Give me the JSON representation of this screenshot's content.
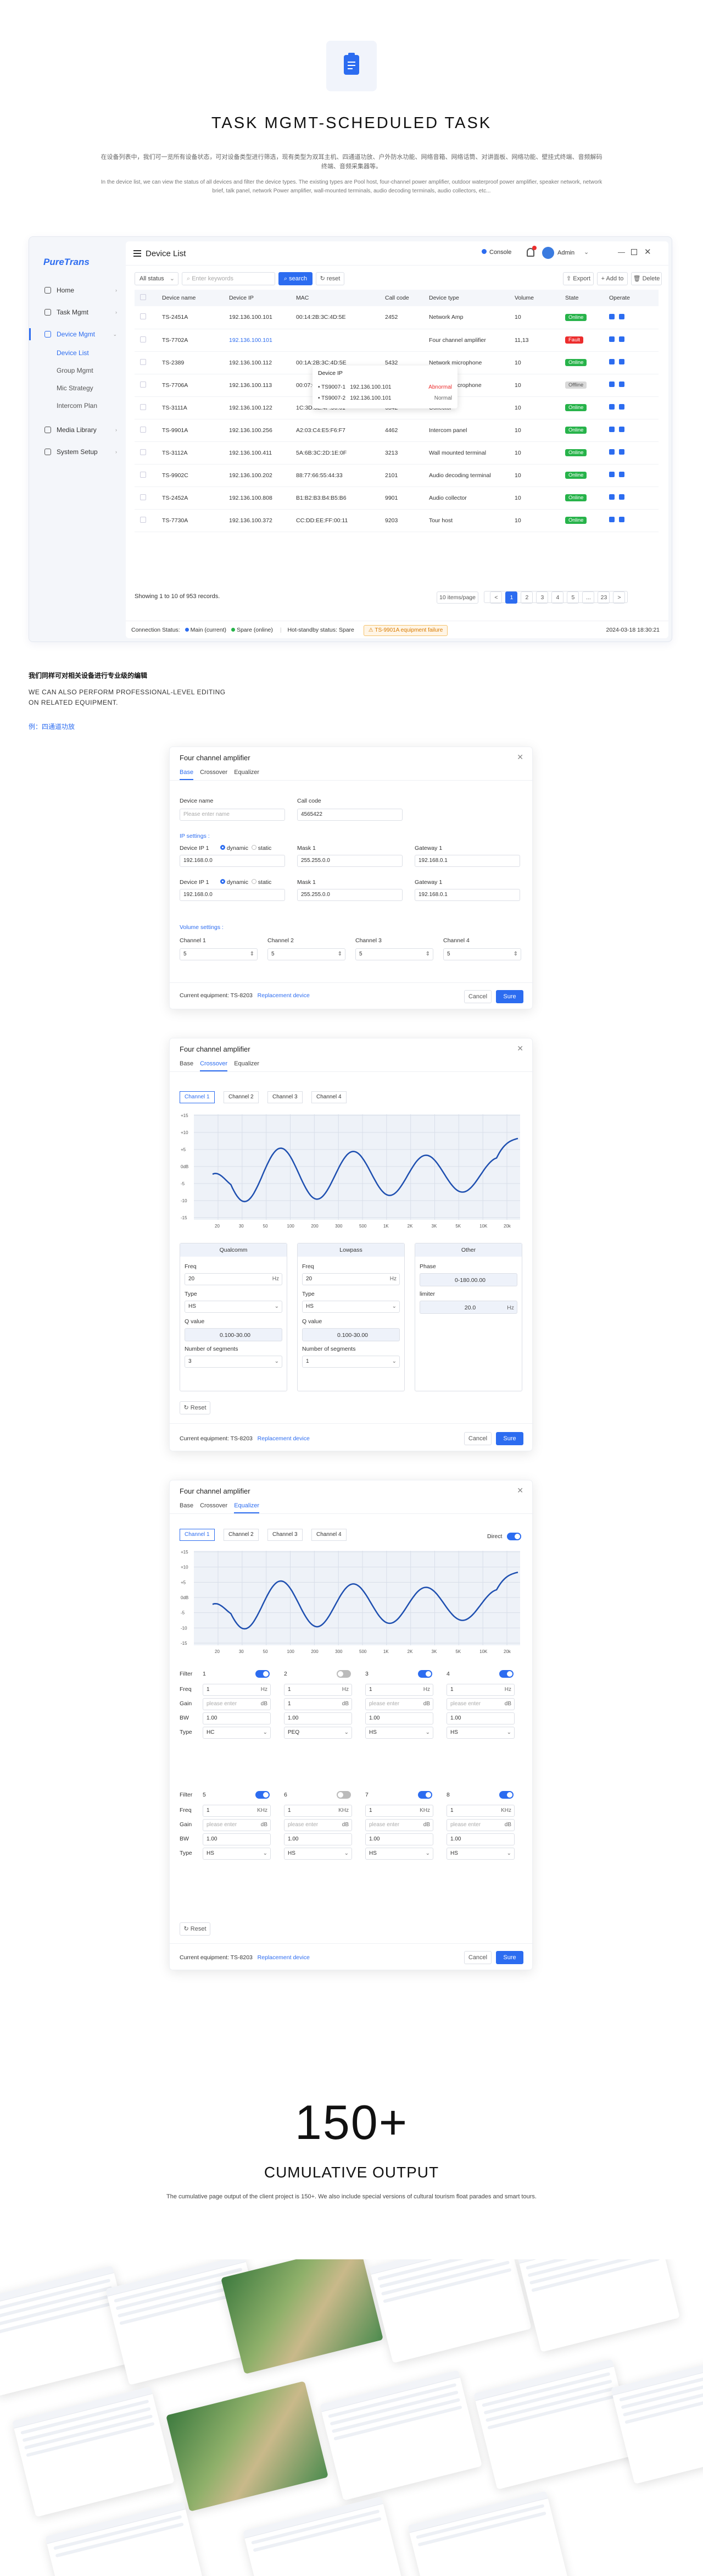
{
  "hero": {
    "title": "TASK MGMT-SCHEDULED TASK",
    "desc_cn": "在设备列表中，我们可一览所有设备状态，可对设备类型进行筛选，现有类型为双耳主机、四通道功放、户外防水功能、网络音箱、网络话筒、对讲面板、网络功能、壁挂式终端、音频解码终端、音频采集器等。",
    "desc_en": "In the device list, we can view the status of all devices and filter the device types. The existing types are Pool host, four-channel power amplifier, outdoor waterproof power amplifier, speaker network, network brief, talk panel, network Power amplifier, wall-mounted terminals, audio decoding terminals, audio collectors, etc..."
  },
  "app": {
    "logo": "PureTrans",
    "nav": [
      {
        "label": "Home"
      },
      {
        "label": "Task Mgmt"
      },
      {
        "label": "Device Mgmt"
      },
      {
        "label": "Media Library"
      },
      {
        "label": "System Setup"
      }
    ],
    "subnav": [
      "Device List",
      "Group Mgmt",
      "Mic Strategy",
      "Intercom Plan"
    ],
    "page_title": "Device List",
    "top_right": {
      "console": "Console",
      "user": "Admin"
    },
    "toolbar": {
      "status_select": "All status",
      "search_placeholder": "Enter keywords",
      "search": "search",
      "reset": "reset",
      "export": "Export",
      "add": "Add to",
      "delete": "Delete"
    },
    "columns": [
      "Device name",
      "Device IP",
      "MAC",
      "Call code",
      "Device type",
      "Volume",
      "State",
      "Operate"
    ],
    "rows": [
      {
        "name": "TS-2451A",
        "ip": "192.136.100.101",
        "mac": "00:14:2B:3C:4D:5E",
        "code": "2452",
        "type": "Network Amp",
        "vol": "10",
        "state": "Online"
      },
      {
        "name": "TS-7702A",
        "ip": "192.136.100.101",
        "mac": "",
        "code": "",
        "type": "Four channel amplifier",
        "vol": "11,13",
        "state": "Fault"
      },
      {
        "name": "TS-2389",
        "ip": "192.136.100.112",
        "mac": "00:1A:2B:3C:4D:5E",
        "code": "5432",
        "type": "Network microphone",
        "vol": "10",
        "state": "Online"
      },
      {
        "name": "TS-7706A",
        "ip": "192.136.100.113",
        "mac": "00:07:00:09:0A:0B",
        "code": "3311",
        "type": "wireless microphone",
        "vol": "10",
        "state": "Offline"
      },
      {
        "name": "TS-3111A",
        "ip": "192.136.100.122",
        "mac": "1C:3D:3E:4F:50:61",
        "code": "6842",
        "type": "Collector",
        "vol": "10",
        "state": "Online"
      },
      {
        "name": "TS-9901A",
        "ip": "192.136.100.256",
        "mac": "A2:03:C4:E5:F6:F7",
        "code": "4462",
        "type": "Intercom panel",
        "vol": "10",
        "state": "Online"
      },
      {
        "name": "TS-3112A",
        "ip": "192.136.100.411",
        "mac": "5A:6B:3C:2D:1E:0F",
        "code": "3213",
        "type": "Wall mounted terminal",
        "vol": "10",
        "state": "Online"
      },
      {
        "name": "TS-9902C",
        "ip": "192.136.100.202",
        "mac": "88:77:66:55:44:33",
        "code": "2101",
        "type": "Audio decoding terminal",
        "vol": "10",
        "state": "Online"
      },
      {
        "name": "TS-2452A",
        "ip": "192.136.100.808",
        "mac": "B1:B2:B3:B4:B5:B6",
        "code": "9901",
        "type": "Audio collector",
        "vol": "10",
        "state": "Online"
      },
      {
        "name": "TS-7730A",
        "ip": "192.136.100.372",
        "mac": "CC:DD:EE:FF:00:11",
        "code": "9203",
        "type": "Tour host",
        "vol": "10",
        "state": "Online"
      }
    ],
    "popup": {
      "title": "Device IP",
      "items": [
        {
          "name": "TS9007-1",
          "ip": "192.136.100.101",
          "state": "Abnormal"
        },
        {
          "name": "TS9007-2",
          "ip": "192.136.100.101",
          "state": "Normal"
        }
      ]
    },
    "showing": "Showing 1 to 10 of 953 records.",
    "page_size": "10 items/page",
    "pages": [
      "<",
      "1",
      "2",
      "3",
      "4",
      "5",
      "...",
      "23",
      ">"
    ],
    "status_bar": {
      "label": "Connection Status:",
      "main": "Main (current)",
      "spare": "Spare (online)",
      "hot": "Hot-standby status: Spare",
      "warn": "TS-9901A equipment failure",
      "datetime": "2024-03-18  18:30:21"
    }
  },
  "section2": {
    "cn": "我们同样可对相关设备进行专业级的编辑",
    "en": "WE CAN ALSO PERFORM PROFESSIONAL-LEVEL EDITING ON RELATED EQUIPMENT.",
    "example": "例：四通道功放"
  },
  "dialog_common": {
    "title": "Four channel amplifier",
    "tabs": [
      "Base",
      "Crossover",
      "Equalizer"
    ],
    "current": "Current equipment: TS-8203",
    "replace": "Replacement device",
    "cancel": "Cancel",
    "sure": "Sure"
  },
  "dlg_base": {
    "device_name": "Device name",
    "device_name_ph": "Please enter name",
    "call_code": "Call code",
    "call_code_val": "4565422",
    "ip_settings": "IP settings :",
    "dev_ip1": "Device IP 1",
    "dev_ip2": "Device IP 1",
    "dynamic": "dynamic",
    "static": "static",
    "ip_val": "192.168.0.0",
    "mask": "Mask 1",
    "mask_val": "255.255.0.0",
    "gateway": "Gateway 1",
    "gateway_val": "192.168.0.1",
    "vol_settings": "Volume settings :",
    "channels": [
      "Channel 1",
      "Channel 2",
      "Channel 3",
      "Channel 4"
    ],
    "channel_val": "5"
  },
  "dlg_cross": {
    "channels": [
      "Channel 1",
      "Channel 2",
      "Channel 3",
      "Channel 4"
    ],
    "yticks": [
      "+15",
      "+10",
      "+5",
      "0dB",
      "-5",
      "-10",
      "-15"
    ],
    "xticks": [
      "20",
      "30",
      "50",
      "100",
      "200",
      "300",
      "500",
      "1K",
      "2K",
      "3K",
      "5K",
      "10K",
      "20k"
    ],
    "panels": {
      "qual": "Qualcomm",
      "low": "Lowpass",
      "other": "Other",
      "freq": "Freq",
      "freq_val": "20",
      "hz": "Hz",
      "type": "Type",
      "type_val": "HS",
      "qvalue": "Q value",
      "q_ph": "0.100-30.00",
      "segs": "Number of segments",
      "seg_val": "3",
      "seg_val2": "1",
      "phase": "Phase",
      "phase_ph": "0-180.00.00",
      "limiter": "limiter",
      "limiter_ph": "20.0"
    },
    "reset": "Reset"
  },
  "dlg_eq": {
    "direct": "Direct",
    "filter": "Filter",
    "freq": "Freq",
    "gain": "Gain",
    "bw": "BW",
    "type": "Type",
    "row1": [
      {
        "n": "1",
        "freq": "1",
        "unit": "Hz",
        "gain": "please enter",
        "bw": "1.00",
        "type": "HC",
        "on": true
      },
      {
        "n": "2",
        "freq": "1",
        "unit": "Hz",
        "gain": "1",
        "bw": "1.00",
        "type": "PEQ",
        "on": false
      },
      {
        "n": "3",
        "freq": "1",
        "unit": "Hz",
        "gain": "please enter",
        "bw": "1.00",
        "type": "HS",
        "on": true
      },
      {
        "n": "4",
        "freq": "1",
        "unit": "Hz",
        "gain": "please enter",
        "bw": "1.00",
        "type": "HS",
        "on": true
      }
    ],
    "row2": [
      {
        "n": "5",
        "freq": "1",
        "unit": "KHz",
        "gain": "please enter",
        "bw": "1.00",
        "type": "HS",
        "on": true
      },
      {
        "n": "6",
        "freq": "1",
        "unit": "KHz",
        "gain": "please enter",
        "bw": "1.00",
        "type": "HS",
        "on": false
      },
      {
        "n": "7",
        "freq": "1",
        "unit": "KHz",
        "gain": "please enter",
        "bw": "1.00",
        "type": "HS",
        "on": true
      },
      {
        "n": "8",
        "freq": "1",
        "unit": "KHz",
        "gain": "please enter",
        "bw": "1.00",
        "type": "HS",
        "on": true
      }
    ],
    "db": "dB"
  },
  "final": {
    "big": "150+",
    "title": "CUMULATIVE OUTPUT",
    "sub": "The cumulative page output of the client project is 150+. We also include special versions of cultural tourism float parades and smart tours."
  }
}
